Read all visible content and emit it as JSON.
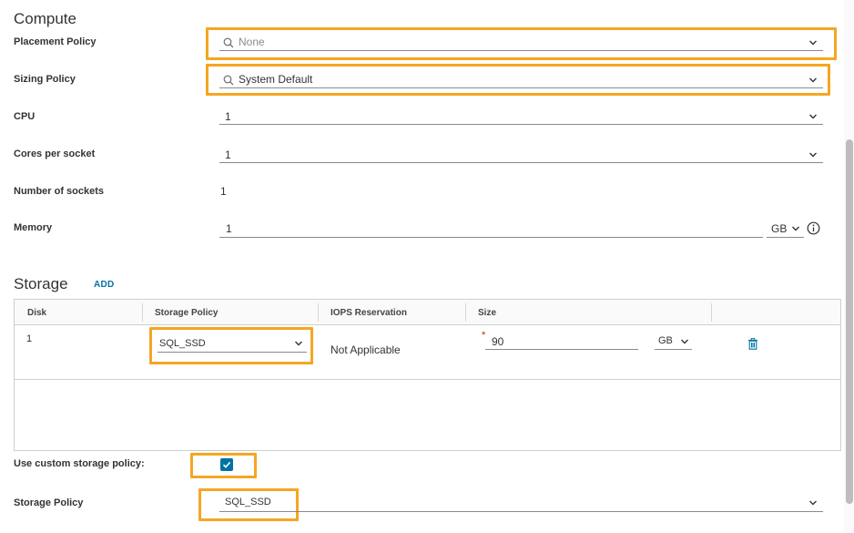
{
  "compute": {
    "title": "Compute",
    "placement_policy": {
      "label": "Placement Policy",
      "placeholder": "None"
    },
    "sizing_policy": {
      "label": "Sizing Policy",
      "value": "System Default"
    },
    "cpu": {
      "label": "CPU",
      "value": "1"
    },
    "cores_per_socket": {
      "label": "Cores per socket",
      "value": "1"
    },
    "sockets": {
      "label": "Number of sockets",
      "value": "1"
    },
    "memory": {
      "label": "Memory",
      "value": "1",
      "unit": "GB"
    }
  },
  "storage": {
    "title": "Storage",
    "add_label": "ADD",
    "columns": [
      "Disk",
      "Storage Policy",
      "IOPS Reservation",
      "Size"
    ],
    "rows": [
      {
        "disk": "1",
        "policy": "SQL_SSD",
        "iops": "Not Applicable",
        "size": "90",
        "unit": "GB"
      }
    ],
    "custom_policy": {
      "label": "Use custom storage policy:",
      "checked": true
    },
    "storage_policy": {
      "label": "Storage Policy",
      "value": "SQL_SSD"
    }
  },
  "colors": {
    "highlight": "#f5a623",
    "accent": "#0072a3",
    "required": "#c92100"
  }
}
